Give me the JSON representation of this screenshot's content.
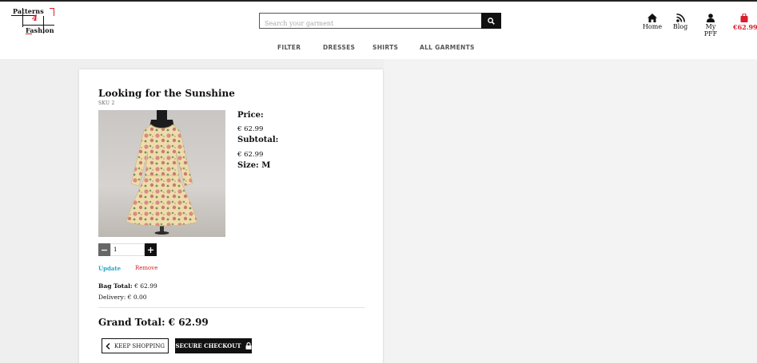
{
  "logo": {
    "line1": "Patterns",
    "number": "4",
    "line2": "Fashion"
  },
  "search": {
    "placeholder": "Search your garment"
  },
  "nav": {
    "home": "Home",
    "blog": "Blog",
    "account": "My PFF",
    "bag_total": "€62.99"
  },
  "menu": {
    "filter": "FILTER",
    "dresses": "DRESSES",
    "shirts": "SHIRTS",
    "all": "ALL GARMENTS"
  },
  "item": {
    "title": "Looking for the Sunshine",
    "sku": "SKU 2",
    "price_label": "Price:",
    "price": "€ 62.99",
    "subtotal_label": "Subtotal:",
    "subtotal": "€ 62.99",
    "size_label": "Size: M",
    "quantity": "1"
  },
  "actions": {
    "update": "Update",
    "remove": "Remove"
  },
  "totals": {
    "bag_label": "Bag Total:",
    "bag_value": "€ 62.99",
    "delivery_label": "Delivery:",
    "delivery_value": "€ 0.00",
    "grand": "Grand Total: € 62.99"
  },
  "buttons": {
    "keep_shopping": "KEEP SHOPPING",
    "checkout": "SECURE CHECKOUT"
  },
  "colors": {
    "accent_red": "#d91f2b",
    "link_blue": "#2aa1c6",
    "dark": "#111111"
  }
}
